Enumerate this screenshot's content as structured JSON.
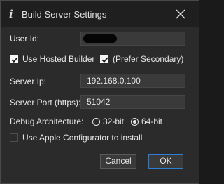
{
  "window": {
    "title_icon": "i",
    "title": "Build Server Settings",
    "close_glyph": "close-icon"
  },
  "form": {
    "user_id": {
      "label": "User Id:",
      "value": ""
    },
    "use_hosted_builder": {
      "label": "Use Hosted Builder",
      "checked": true
    },
    "prefer_secondary": {
      "label": "(Prefer Secondary)",
      "checked": true
    },
    "server_ip": {
      "label": "Server Ip:",
      "value": "192.168.0.100"
    },
    "server_port": {
      "label": "Server Port (https):",
      "value": "51042"
    },
    "debug_architecture": {
      "label": "Debug Architecture:",
      "options": [
        "32-bit",
        "64-bit"
      ],
      "selected": "64-bit"
    },
    "use_apple_configurator": {
      "label": "Use Apple Configurator to install",
      "checked": false,
      "enabled": false
    }
  },
  "buttons": {
    "cancel": "Cancel",
    "ok": "OK"
  },
  "colors": {
    "window_bg": "#2b2b2b",
    "titlebar_bg": "#1f1f1f",
    "field_bg": "#3a3a3a",
    "accent": "#2a7fd4",
    "text": "#e6e6e6"
  }
}
